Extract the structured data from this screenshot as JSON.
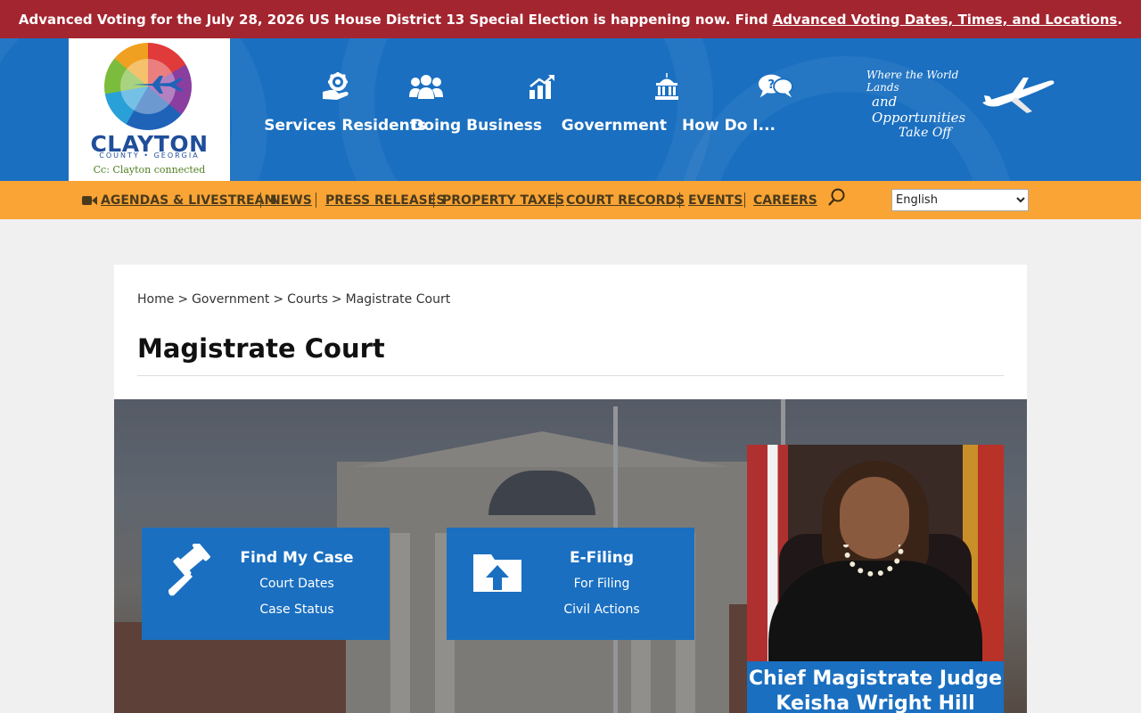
{
  "alert": {
    "text": "Advanced Voting for the July 28, 2026 US House District 13 Special Election is happening now. Find ",
    "link": "Advanced Voting Dates, Times, and Locations",
    "end": "."
  },
  "logo": {
    "name": "CLAYTON",
    "county": "COUNTY • GEORGIA",
    "tagline": "Cc: Clayton connected"
  },
  "mainnav": [
    {
      "label": "Services",
      "icon": "gear-hand-icon"
    },
    {
      "label": "Residents",
      "icon": "people-icon"
    },
    {
      "label": "Doing Business",
      "icon": "chart-icon"
    },
    {
      "label": "Government",
      "icon": "capitol-icon"
    },
    {
      "label": "How Do I...",
      "icon": "question-chat-icon"
    }
  ],
  "tagline": {
    "line1": "Where the World Lands",
    "line2": "and Opportunities",
    "line3": "Take Off"
  },
  "utility": [
    {
      "label": "AGENDAS & LIVESTREAM",
      "icon": "video-camera-icon"
    },
    {
      "label": "NEWS"
    },
    {
      "label": "PRESS RELEASES"
    },
    {
      "label": "PROPERTY TAXES"
    },
    {
      "label": "COURT RECORDS"
    },
    {
      "label": "EVENTS"
    },
    {
      "label": "CAREERS"
    }
  ],
  "language": {
    "selected": "English"
  },
  "breadcrumb": [
    "Home",
    "Government",
    "Courts",
    "Magistrate Court"
  ],
  "breadcrumb_sep": ">",
  "page_title": "Magistrate Court",
  "tiles": [
    {
      "title": "Find My Case",
      "sub1": "Court Dates",
      "sub2": "Case Status",
      "icon": "gavel-icon"
    },
    {
      "title": "E-Filing",
      "sub1": "For Filing",
      "sub2": "Civil Actions",
      "icon": "upload-folder-icon"
    }
  ],
  "judge": {
    "caption_line1": "Chief Magistrate Judge",
    "caption_line2": "Keisha Wright Hill"
  },
  "colors": {
    "alert": "#a32530",
    "brand_blue": "#1a6fc0",
    "utility_orange": "#f9a435"
  }
}
